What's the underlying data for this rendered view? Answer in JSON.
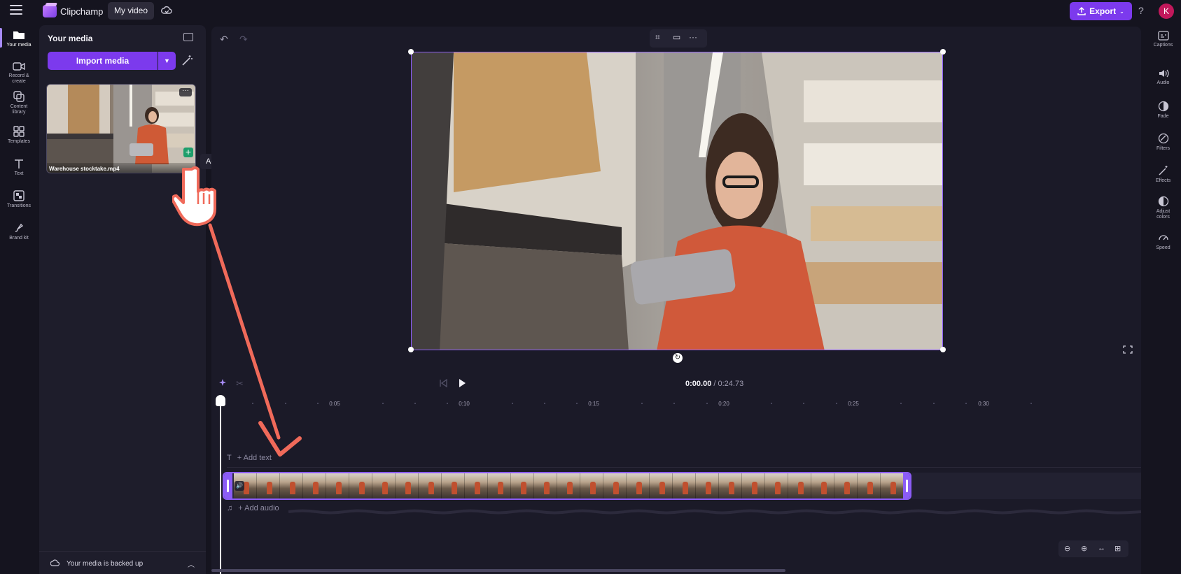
{
  "app": {
    "name": "Clipchamp",
    "project_title": "My video"
  },
  "header": {
    "export_label": "Export",
    "help": "?",
    "avatar_initial": "K"
  },
  "left_rail": {
    "items": [
      {
        "label": "Your media",
        "icon": "folder-icon"
      },
      {
        "label": "Record & create",
        "icon": "video-camera-icon"
      },
      {
        "label": "Content library",
        "icon": "library-icon"
      },
      {
        "label": "Templates",
        "icon": "templates-icon"
      },
      {
        "label": "Text",
        "icon": "text-icon"
      },
      {
        "label": "Transitions",
        "icon": "transitions-icon"
      },
      {
        "label": "Brand kit",
        "icon": "brand-kit-icon"
      }
    ]
  },
  "media_panel": {
    "title": "Your media",
    "import_label": "Import media",
    "media_item": {
      "name": "Warehouse stocktake.mp4",
      "more": "···",
      "add": "+"
    },
    "tooltip": "Add to timeline",
    "backup_status": "Your media is backed up"
  },
  "player": {
    "current_time": "0:00.00",
    "total_time": "/ 0:24.73"
  },
  "timeline": {
    "tick_labels": [
      "0:05",
      "0:10",
      "0:15",
      "0:20",
      "0:25",
      "0:30"
    ],
    "add_text": "+ Add text",
    "add_audio": "+ Add audio"
  },
  "right_rail": {
    "items": [
      {
        "label": "Captions",
        "icon": "captions-icon"
      },
      {
        "label": "Audio",
        "icon": "audio-icon"
      },
      {
        "label": "Fade",
        "icon": "fade-icon"
      },
      {
        "label": "Filters",
        "icon": "filters-icon"
      },
      {
        "label": "Effects",
        "icon": "effects-icon"
      },
      {
        "label": "Adjust colors",
        "icon": "adjust-colors-icon"
      },
      {
        "label": "Speed",
        "icon": "speed-icon"
      }
    ]
  },
  "colors": {
    "accent": "#7c3aed",
    "arrow": "#f06a5a",
    "clip_border": "#8b5cf6"
  }
}
